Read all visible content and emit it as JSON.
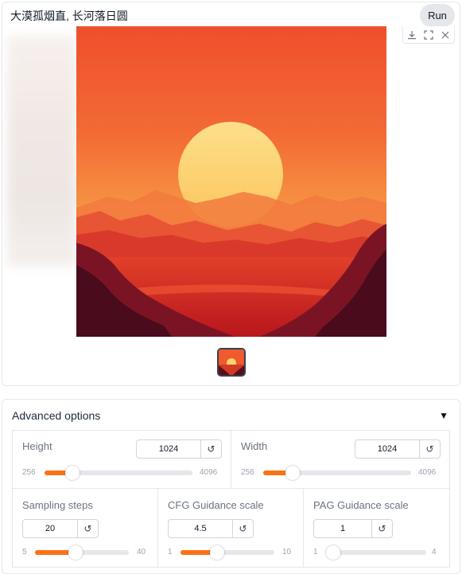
{
  "prompt": {
    "text": "大漠孤烟直, 长河落日圆"
  },
  "run_button": {
    "label": "Run"
  },
  "gallery": {
    "toolbar_icons": [
      "download-icon",
      "fullscreen-icon",
      "close-icon"
    ]
  },
  "advanced": {
    "title": "Advanced options",
    "toggle": "▼",
    "height": {
      "label": "Height",
      "value": "1024",
      "min": "256",
      "max": "4096",
      "fraction": 0.19
    },
    "width": {
      "label": "Width",
      "value": "1024",
      "min": "256",
      "max": "4096",
      "fraction": 0.2
    },
    "sampling_steps": {
      "label": "Sampling steps",
      "value": "20",
      "min": "5",
      "max": "40",
      "fraction": 0.43
    },
    "cfg_scale": {
      "label": "CFG Guidance scale",
      "value": "4.5",
      "min": "1",
      "max": "10",
      "fraction": 0.39
    },
    "pag_scale": {
      "label": "PAG Guidance scale",
      "value": "1",
      "min": "1",
      "max": "4",
      "fraction": 0.0
    },
    "reset_glyph": "↺"
  },
  "colors": {
    "accent": "#f97316",
    "sky_top": "#f2562e",
    "sun": "#fcd36b"
  }
}
